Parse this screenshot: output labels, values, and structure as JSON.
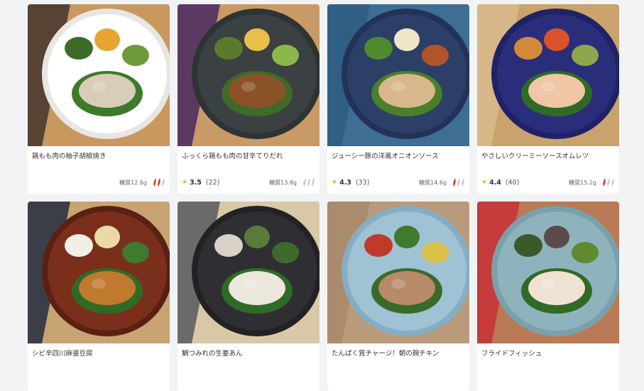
{
  "colors": {
    "star": "#f5b400",
    "chili_on": "#d6321f",
    "chili_off": "#c9c9c9"
  },
  "cards": [
    {
      "name": "鶏もも肉の柚子胡椒焼き",
      "star_icon": "",
      "score": "",
      "count": "",
      "sugar": "糖質12.6g",
      "spice_level": 2,
      "photo": {
        "bg": "#c9985f",
        "cloth": "#4a3a30",
        "plate": "#ffffff",
        "rim": "#e8e6e2",
        "sides": [
          "#3f6b2a",
          "#e6a531",
          "#6e9a3c"
        ],
        "main": "#d9cdb8",
        "greens": "#3d7a2b"
      }
    },
    {
      "name": "ふっくら鶏もも肉の甘辛てりだれ",
      "star_icon": "★",
      "score": "3.5",
      "count": "(22)",
      "sugar": "糖質13.8g",
      "spice_level": 0,
      "photo": {
        "bg": "#c89a66",
        "cloth": "#4f2f63",
        "plate": "#3b4142",
        "rim": "#2e3334",
        "sides": [
          "#5b7a2e",
          "#e6c04a",
          "#8bb84a"
        ],
        "main": "#8a5226",
        "greens": "#3f6a2a"
      }
    },
    {
      "name": "ジューシー豚の洋風オニオンソース",
      "star_icon": "★",
      "score": "4.3",
      "count": "(33)",
      "sugar": "糖質14.6g",
      "spice_level": 1,
      "photo": {
        "bg": "#3f6e95",
        "cloth": "#2f5d83",
        "plate": "#2c3f66",
        "rim": "#223357",
        "sides": [
          "#4f8a2f",
          "#efe6c8",
          "#b2542a"
        ],
        "main": "#d8b88a",
        "greens": "#4a7f2b"
      }
    },
    {
      "name": "やさしいクリーミーソースオムレツ",
      "star_icon": "★",
      "score": "4.4",
      "count": "(40)",
      "sugar": "糖質15.2g",
      "spice_level": 1,
      "photo": {
        "bg": "#c9a26e",
        "cloth": "#d8b98a",
        "plate": "#2a2d7a",
        "rim": "#1f2266",
        "sides": [
          "#d28a3a",
          "#d9532a",
          "#8fa64a"
        ],
        "main": "#f0c6a6",
        "greens": "#2f6b25"
      }
    },
    {
      "name": "シビ辛四川麻婆豆腐",
      "star_icon": "",
      "score": "",
      "count": "",
      "sugar": "",
      "spice_level": 0,
      "photo": {
        "bg": "#c8a472",
        "cloth": "#2c3342",
        "plate": "#7a2f1c",
        "rim": "#5a2012",
        "sides": [
          "#f2efe6",
          "#e9d9a8",
          "#3f7a2f"
        ],
        "main": "#c07a2e",
        "greens": "#2f6b25"
      }
    },
    {
      "name": "鯛つみれの生姜あん",
      "star_icon": "",
      "score": "",
      "count": "",
      "sugar": "",
      "spice_level": 0,
      "photo": {
        "bg": "#d9c8a8",
        "cloth": "#5f5f62",
        "plate": "#2f2f33",
        "rim": "#222226",
        "sides": [
          "#d9d3c8",
          "#5a7a3a",
          "#3f6a2f"
        ],
        "main": "#ece7dc",
        "greens": "#2f6b25"
      }
    },
    {
      "name": "たんぱく質チャージ！朝の麹チキン",
      "star_icon": "",
      "score": "",
      "count": "",
      "sugar": "",
      "spice_level": 0,
      "photo": {
        "bg": "#b99a7a",
        "cloth": "#a88a6a",
        "plate": "#9fc2d4",
        "rim": "#86adc2",
        "sides": [
          "#c03a2a",
          "#3f7a2f",
          "#d9c04a"
        ],
        "main": "#b88a6a",
        "greens": "#3a6a2a"
      }
    },
    {
      "name": "フライドフィッシュ",
      "star_icon": "",
      "score": "",
      "count": "",
      "sugar": "",
      "spice_level": 0,
      "photo": {
        "bg": "#b97a55",
        "cloth": "#c8343a",
        "plate": "#8fb3bd",
        "rim": "#7aa0ab",
        "sides": [
          "#3a5a2a",
          "#5a4a4a",
          "#5f8a2f"
        ],
        "main": "#f0e2d2",
        "greens": "#2f6b25"
      }
    }
  ]
}
